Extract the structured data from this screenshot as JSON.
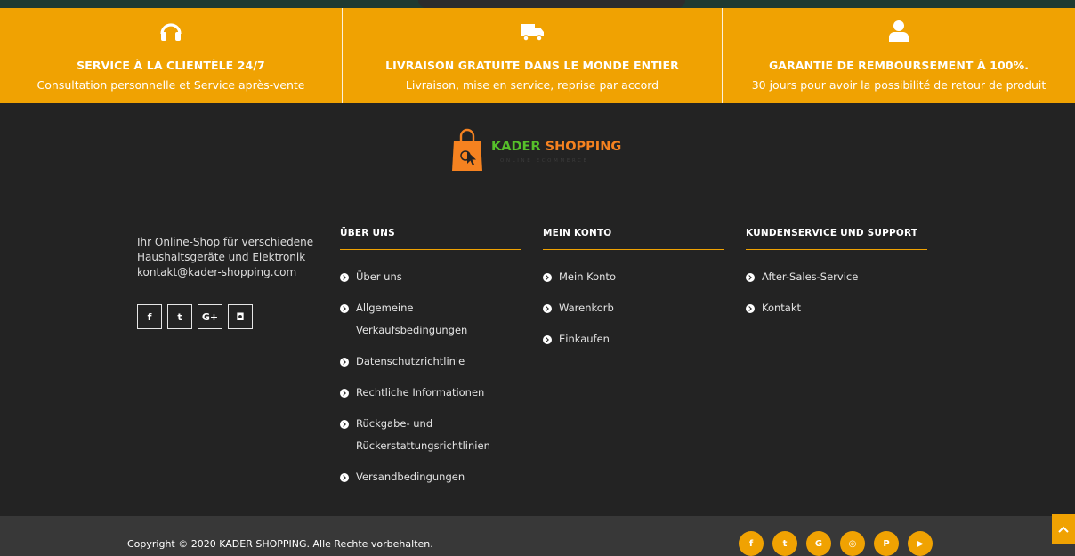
{
  "features": [
    {
      "icon": "headset-icon",
      "title": "SERVICE À LA CLIENTÈLE 24/7",
      "subtitle": "Consultation personnelle et Service après-vente"
    },
    {
      "icon": "truck-icon",
      "title": "LIVRAISON GRATUITE DANS LE MONDE ENTIER",
      "subtitle": "Livraison, mise en service, reprise par accord"
    },
    {
      "icon": "user-icon",
      "title": "GARANTIE DE REMBOURSEMENT À 100%.",
      "subtitle": "30 jours pour avoir la possibilité de retour de produit"
    }
  ],
  "logo": {
    "brand_green": "KADER",
    "brand_orange": "SHOPPING",
    "tagline": "ONLINE ECOMMERCE"
  },
  "about": {
    "line1": "Ihr Online-Shop für verschiedene",
    "line2": "Haushaltsgeräte und Elektronik",
    "email": "kontakt@kader-shopping.com"
  },
  "socials": [
    {
      "icon": "facebook-icon",
      "glyph": "f"
    },
    {
      "icon": "twitter-icon",
      "glyph": "t"
    },
    {
      "icon": "google-plus-icon",
      "glyph": "G+"
    },
    {
      "icon": "instagram-icon",
      "glyph": "◘"
    }
  ],
  "columns": {
    "about_us": {
      "heading": "ÜBER UNS",
      "items": [
        "Über uns",
        "Allgemeine Verkaufsbedingungen",
        "Datenschutzrichtlinie",
        "Rechtliche Informationen",
        "Rückgabe- und Rückerstattungsrichtlinien",
        "Versandbedingungen"
      ]
    },
    "account": {
      "heading": "MEIN KONTO",
      "items": [
        "Mein Konto",
        "Warenkorb",
        "Einkaufen"
      ]
    },
    "support": {
      "heading": "KUNDENSERVICE UND SUPPORT",
      "items": [
        "After-Sales-Service",
        "Kontakt"
      ]
    }
  },
  "bottom": {
    "copyright": "Copyright © 2020 KADER SHOPPING. Alle Rechte vorbehalten.",
    "round_socials": [
      {
        "icon": "facebook-icon",
        "glyph": "f"
      },
      {
        "icon": "twitter-icon",
        "glyph": "t"
      },
      {
        "icon": "google-icon",
        "glyph": "G"
      },
      {
        "icon": "instagram-icon",
        "glyph": "◎"
      },
      {
        "icon": "pinterest-icon",
        "glyph": "P"
      },
      {
        "icon": "youtube-icon",
        "glyph": "▶"
      }
    ]
  },
  "colors": {
    "accent": "#f0a202",
    "footer_bg": "#232323",
    "bottom_bar": "#383838",
    "brand_green": "#56c02a",
    "brand_orange": "#f58220"
  }
}
